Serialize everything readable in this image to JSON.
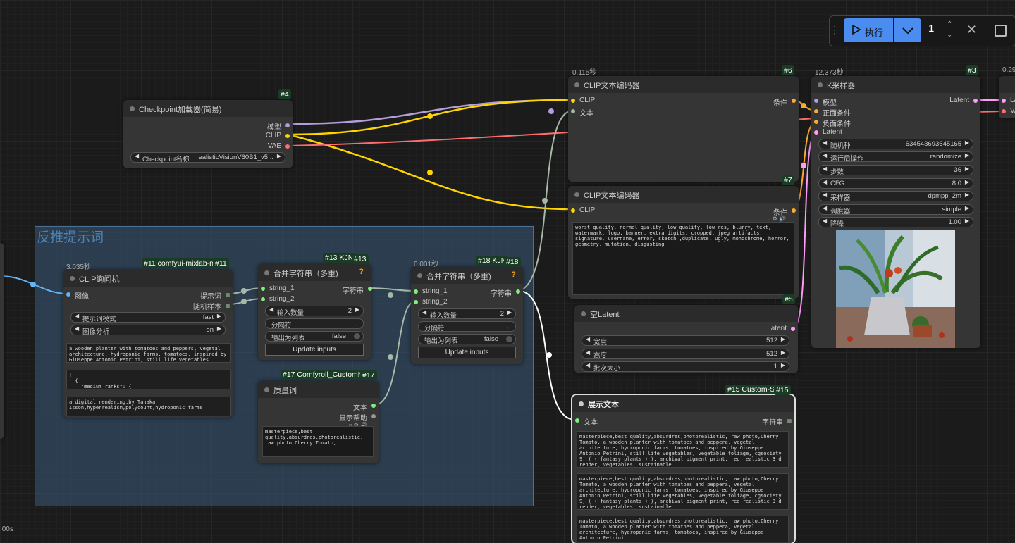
{
  "toolbar": {
    "run_label": "执行",
    "batch_count": "1"
  },
  "group": {
    "title": "反推提示词"
  },
  "bottom_left_time": ".00s",
  "nodes": {
    "checkpoint": {
      "id": "#4",
      "title": "Checkpoint加载器(简易)",
      "outputs": [
        "模型",
        "CLIP",
        "VAE"
      ],
      "ckpt_label": "Checkpoint名称",
      "ckpt_value": "realisticVisionV60B1_v5..."
    },
    "clip_pos": {
      "id": "#6",
      "time": "0.115秒",
      "title": "CLIP文本编码器",
      "inputs": [
        "CLIP",
        "文本"
      ],
      "output": "条件"
    },
    "clip_neg": {
      "id": "#7",
      "title": "CLIP文本编码器",
      "input": "CLIP",
      "output": "条件",
      "text": "worst quality, normal quality, low quality, low res, blurry, text, watermark, logo, banner, extra digits, cropped, jpeg artifacts, signature, username, error, sketch ,duplicate, ugly, monochrome, horror, geometry, mutation, disgusting"
    },
    "ksampler": {
      "id": "#3",
      "time": "12.373秒",
      "title": "K采样器",
      "inputs": [
        "模型",
        "正面条件",
        "负面条件",
        "Latent"
      ],
      "output": "Latent",
      "widgets": [
        {
          "label": "随机种",
          "value": "634543693645165"
        },
        {
          "label": "运行后操作",
          "value": "randomize"
        },
        {
          "label": "步数",
          "value": "36"
        },
        {
          "label": "CFG",
          "value": "8.0"
        },
        {
          "label": "采样器",
          "value": "dpmpp_2m"
        },
        {
          "label": "调度器",
          "value": "simple"
        },
        {
          "label": "降噪",
          "value": "1.00"
        }
      ]
    },
    "vae_decode": {
      "time": "0.29",
      "inputs": [
        "La",
        "VA"
      ]
    },
    "empty_latent": {
      "id": "#5",
      "title": "空Latent",
      "output": "Latent",
      "widgets": [
        {
          "label": "宽度",
          "value": "512"
        },
        {
          "label": "高度",
          "value": "512"
        },
        {
          "label": "批次大小",
          "value": "1"
        }
      ]
    },
    "clip_interrogator": {
      "id": "#11",
      "badge": "#11 comfyui-mixlab-n",
      "time": "3.035秒",
      "title": "CLIP询问机",
      "input": "图像",
      "outputs": [
        "提示词",
        "随机样本"
      ],
      "widgets": [
        {
          "label": "提示词模式",
          "value": "fast"
        },
        {
          "label": "图像分析",
          "value": "on"
        }
      ],
      "text1": "a wooden planter with tomatoes and peppers, vegetal architecture, hydroponic farms, tomatoes, inspired by Giuseppe Antonio Petrini, still life vegetables",
      "text2": "[\n  {\n    \"medium_ranks\": {",
      "text3": "a digital rendering,by Tanaka Isson,hyperrealism,polycount,hydroponic farms"
    },
    "concat13": {
      "id": "#13",
      "badge": "#13 KJN",
      "title": "合并字符串（多重)",
      "inputs": [
        "string_1",
        "string_2"
      ],
      "output": "字符串",
      "widgets": [
        {
          "label": "输入数量",
          "value": "2"
        },
        {
          "label": "分隔符",
          "value": ","
        },
        {
          "label": "输出为列表",
          "value": "false"
        }
      ],
      "button": "Update inputs"
    },
    "concat18": {
      "id": "#18",
      "badge": "#18 KJN",
      "time": "0.001秒",
      "title": "合并字符串（多重)",
      "inputs": [
        "string_1",
        "string_2"
      ],
      "output": "字符串",
      "widgets": [
        {
          "label": "输入数量",
          "value": "2"
        },
        {
          "label": "分隔符",
          "value": ","
        },
        {
          "label": "输出为列表",
          "value": "false"
        }
      ],
      "button": "Update inputs"
    },
    "quality": {
      "id": "#17",
      "badge": "#17 Comfyroll_CustomN",
      "title": "质量词",
      "outputs": [
        "文本",
        "显示帮助"
      ],
      "text": "masterpiece,best quality,absurdres,photorealistic, raw photo,Cherry Tomato,"
    },
    "show_text": {
      "id": "#15",
      "badge": "#15 Custom-Sc",
      "title": "展示文本",
      "input": "文本",
      "output": "字符串",
      "texts": [
        "masterpiece,best quality,absurdres,photorealistic, raw photo,Cherry Tomato, a wooden planter with tomatoes and peppera, vegetal architecture, hydroponic farms, tomatoes, inspired by Giuseppe Antonio Petrini, still life vegetables, vegetable foliage, cgsociety 9, ( ( fantasy plants ) ), archival pigment print, red realistic 3 d render, vegetables, sustainable",
        "masterpiece,best quality,absurdres,photorealistic, raw photo,Cherry Tomato, a wooden planter with tomatoes and peppera, vegetal architecture, hydroponic farms, tomatoes, inspired by Giuseppe Antonio Petrini, still life vegetables, vegetable foliage, cgsociety 9, ( ( fantasy plants ) ), archival pigment print, red realistic 3 d render, vegetables, sustainable",
        "masterpiece,best quality,absurdres,photorealistic, raw photo,Cherry Tomato, a wooden planter with tomatoes and peppera, vegetal architecture, hydroponic farms, tomatoes, inspired by Giuseppe Antonio Petrini"
      ]
    }
  },
  "colors": {
    "model": "#b39ddb",
    "clip": "#ffd500",
    "vae": "#ff6e6e",
    "conditioning": "#ffa931",
    "latent": "#ff9cf9",
    "string": "#7ef07e",
    "image": "#64b5f6",
    "text_wire": "#b0c4b0",
    "white_wire": "#ffffff"
  }
}
